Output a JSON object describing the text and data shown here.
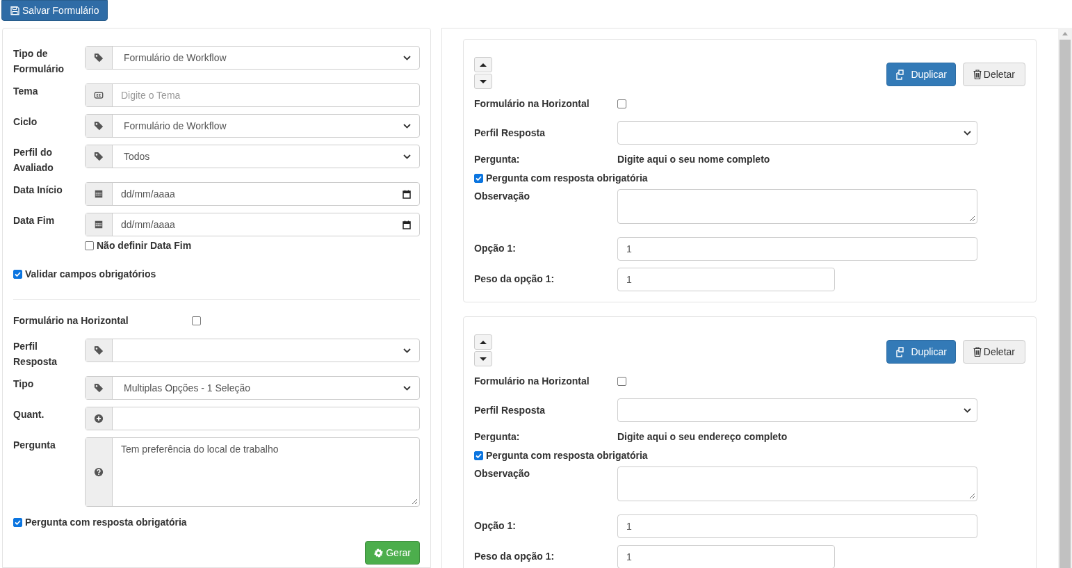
{
  "save_button": {
    "label": "Salvar Formulário"
  },
  "left_form": {
    "fields": [
      {
        "kind": "select",
        "label": "Tipo de Formulário",
        "value": "Formulário de Workflow"
      },
      {
        "kind": "text",
        "label": "Tema",
        "placeholder": "Digite o Tema"
      },
      {
        "kind": "select",
        "label": "Ciclo",
        "value": "Formulário de Workflow"
      },
      {
        "kind": "select",
        "label": "Perfil do Avaliado",
        "value": "Todos"
      },
      {
        "kind": "date",
        "label": "Data Início",
        "placeholder": "dd/mm/aaaa"
      },
      {
        "kind": "date",
        "label": "Data Fim",
        "placeholder": "dd/mm/aaaa"
      }
    ],
    "no_end_date": {
      "label": "Não definir Data Fim",
      "checked": false
    },
    "validate_required": {
      "label": "Validar campos obrigatórios",
      "checked": true
    },
    "horizontal": {
      "label": "Formulário na Horizontal",
      "checked": false
    },
    "question_fields": [
      {
        "kind": "select",
        "label": "Perfil Resposta"
      },
      {
        "kind": "select",
        "label": "Tipo",
        "value": "Multiplas Opções - 1 Seleção"
      },
      {
        "kind": "number",
        "label": "Quant."
      },
      {
        "kind": "textarea",
        "label": "Pergunta",
        "value": "Tem preferência do local de trabalho"
      }
    ],
    "required": {
      "label": "Pergunta com resposta obrigatória",
      "checked": true
    },
    "generate_button": {
      "label": "Gerar"
    }
  },
  "question_cards": [
    {
      "duplicate_label": "Duplicar",
      "delete_label": "Deletar",
      "horizontal": {
        "label": "Formulário na Horizontal",
        "checked": false
      },
      "profile_label": "Perfil Resposta",
      "question_label": "Pergunta:",
      "question_text": "Digite aqui o seu nome completo",
      "required": {
        "label": "Pergunta com resposta obrigatória",
        "checked": true
      },
      "note_label": "Observação",
      "option_label": "Opção 1:",
      "option_value": "1",
      "weight_label": "Peso da opção 1:",
      "weight_value": "1"
    },
    {
      "duplicate_label": "Duplicar",
      "delete_label": "Deletar",
      "horizontal": {
        "label": "Formulário na Horizontal",
        "checked": false
      },
      "profile_label": "Perfil Resposta",
      "question_label": "Pergunta:",
      "question_text": "Digite aqui o seu endereço completo",
      "required": {
        "label": "Pergunta com resposta obrigatória",
        "checked": true
      },
      "note_label": "Observação",
      "option_label": "Opção 1:",
      "option_value": "1",
      "weight_label": "Peso da opção 1:",
      "weight_value": "1"
    }
  ]
}
